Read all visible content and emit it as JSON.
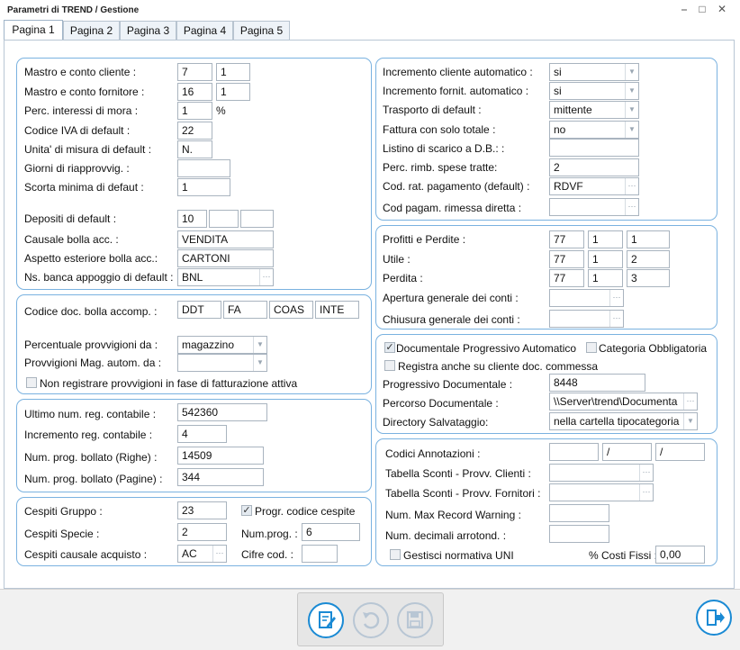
{
  "window": {
    "title": "Parametri di TREND / Gestione"
  },
  "tabs": [
    "Pagina 1",
    "Pagina 2",
    "Pagina 3",
    "Pagina 4",
    "Pagina 5"
  ],
  "g1": {
    "mastro_cliente_label": "Mastro e conto cliente :",
    "mastro_cliente_1": "7",
    "mastro_cliente_2": "1",
    "mastro_fornitore_label": "Mastro e conto fornitore :",
    "mastro_fornitore_1": "16",
    "mastro_fornitore_2": "1",
    "interessi_label": "Perc. interessi di mora :",
    "interessi_value": "1",
    "interessi_unit": "%",
    "iva_label": "Codice IVA di default :",
    "iva_value": "22",
    "um_label": "Unita' di misura di default :",
    "um_value": "N.",
    "giorni_label": "Giorni di riapprovvig. :",
    "giorni_value": "",
    "scorta_label": "Scorta minima di defaut :",
    "scorta_value": "1",
    "depositi_label": "Depositi di default :",
    "depositi_1": "10",
    "depositi_2": "",
    "depositi_3": "",
    "causale_label": "Causale bolla acc. :",
    "causale_value": "VENDITA",
    "aspetto_label": "Aspetto esteriore bolla acc.:",
    "aspetto_value": "CARTONI",
    "banca_label": "Ns. banca appoggio di default :",
    "banca_value": "BNL"
  },
  "g2": {
    "codice_doc_label": "Codice doc. bolla accomp. :",
    "codici": [
      "DDT",
      "FA",
      "COAS",
      "INTE"
    ],
    "provv_da_label": "Percentuale provvigioni da :",
    "provv_da_value": "magazzino",
    "provv_mag_label": "Provvigioni Mag. autom. da :",
    "provv_mag_value": "",
    "non_registrare_label": "Non registrare provvigioni in fase di fatturazione attiva"
  },
  "g3": {
    "ultimo_label": "Ultimo num. reg. contabile :",
    "ultimo_value": "542360",
    "incremento_label": "Incremento reg. contabile :",
    "incremento_value": "4",
    "righe_label": "Num. prog. bollato (Righe) :",
    "righe_value": "14509",
    "pagine_label": "Num. prog. bollato (Pagine) :",
    "pagine_value": "344"
  },
  "g4": {
    "gruppo_label": "Cespiti Gruppo :",
    "gruppo_value": "23",
    "progr_label": "Progr. codice cespite",
    "specie_label": "Cespiti Specie :",
    "specie_value": "2",
    "numprog_label": "Num.prog. :",
    "numprog_value": "6",
    "causale_label": "Cespiti causale acquisto :",
    "causale_value": "AC",
    "cifre_label": "Cifre cod. :",
    "cifre_value": ""
  },
  "g5": {
    "inc_cliente_label": "Incremento cliente automatico :",
    "inc_cliente_value": "si",
    "inc_fornit_label": "Incremento fornit.  automatico :",
    "inc_fornit_value": "si",
    "trasporto_label": "Trasporto di default :",
    "trasporto_value": "mittente",
    "fattura_label": "Fattura con solo totale :",
    "fattura_value": "no",
    "listino_label": "Listino di scarico a D.B.: :",
    "listino_value": "",
    "rimb_label": "Perc. rimb. spese tratte:",
    "rimb_value": "2",
    "rat_label": "Cod. rat. pagamento (default) :",
    "rat_value": "RDVF",
    "rimessa_label": "Cod pagam. rimessa diretta :",
    "rimessa_value": ""
  },
  "g6": {
    "profitti_label": "Profitti e Perdite :",
    "profitti": [
      "77",
      "1",
      "1"
    ],
    "utile_label": "Utile  :",
    "utile": [
      "77",
      "1",
      "2"
    ],
    "perdita_label": "Perdita :",
    "perdita": [
      "77",
      "1",
      "3"
    ],
    "apertura_label": "Apertura generale dei conti :",
    "apertura_value": "",
    "chiusura_label": "Chiusura generale dei conti :",
    "chiusura_value": ""
  },
  "g7": {
    "doc_prog_label": "Documentale Progressivo Automatico",
    "categoria_label": "Categoria Obbligatoria",
    "registra_label": "Registra anche su cliente doc. commessa",
    "progressivo_label": "Progressivo Documentale :",
    "progressivo_value": "8448",
    "percorso_label": "Percorso Documentale :",
    "percorso_value": "\\\\Server\\trend\\Documenta",
    "directory_label": "Directory Salvataggio:",
    "directory_value": "nella cartella tipocategoria"
  },
  "g8": {
    "annotazioni_label": "Codici Annotazioni :",
    "annotazioni_1": "",
    "annotazioni_2": "/",
    "annotazioni_3": "/",
    "sconti_clienti_label": "Tabella Sconti - Provv. Clienti :",
    "sconti_fornitori_label": "Tabella Sconti - Provv. Fornitori :",
    "max_record_label": "Num. Max Record Warning :",
    "max_record_value": "",
    "decimali_label": "Num. decimali arrotond. :",
    "decimali_value": "",
    "uni_label": "Gestisci normativa UNI",
    "costi_label": "% Costi Fissi :",
    "costi_value": "0,00"
  },
  "colors": {
    "accent": "#1a8ad4",
    "group_border": "#7ab2e0",
    "tab_underline": "#e8a040"
  }
}
